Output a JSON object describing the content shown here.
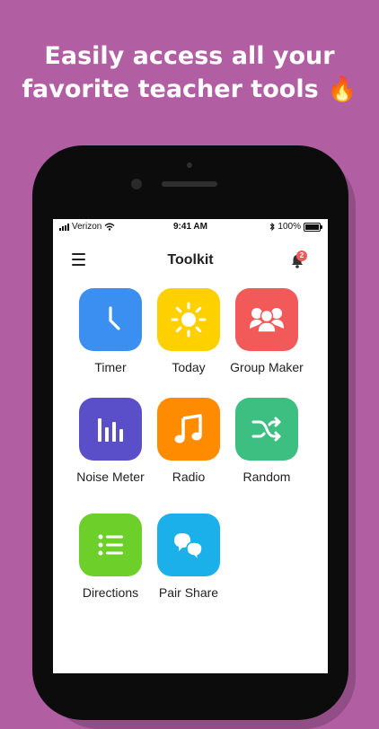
{
  "headline": {
    "line1": "Easily access all your",
    "line2": "favorite teacher tools",
    "emoji": "🔥"
  },
  "status_bar": {
    "carrier": "Verizon",
    "time": "9:41 AM",
    "battery": "100%"
  },
  "navbar": {
    "title": "Toolkit",
    "badge_count": "2"
  },
  "tools": [
    {
      "label": "Timer",
      "color": "#3b8ff0",
      "icon": "clock-icon"
    },
    {
      "label": "Today",
      "color": "#ffd000",
      "icon": "sun-icon"
    },
    {
      "label": "Group Maker",
      "color": "#f25a5a",
      "icon": "group-icon"
    },
    {
      "label": "Noise Meter",
      "color": "#5a4fc9",
      "icon": "noise-meter-icon"
    },
    {
      "label": "Radio",
      "color": "#ff8c00",
      "icon": "music-note-icon"
    },
    {
      "label": "Random",
      "color": "#3dbf81",
      "icon": "shuffle-icon"
    },
    {
      "label": "Directions",
      "color": "#6ccf2a",
      "icon": "list-icon"
    },
    {
      "label": "Pair Share",
      "color": "#1cb0eb",
      "icon": "chat-bubbles-icon"
    }
  ]
}
